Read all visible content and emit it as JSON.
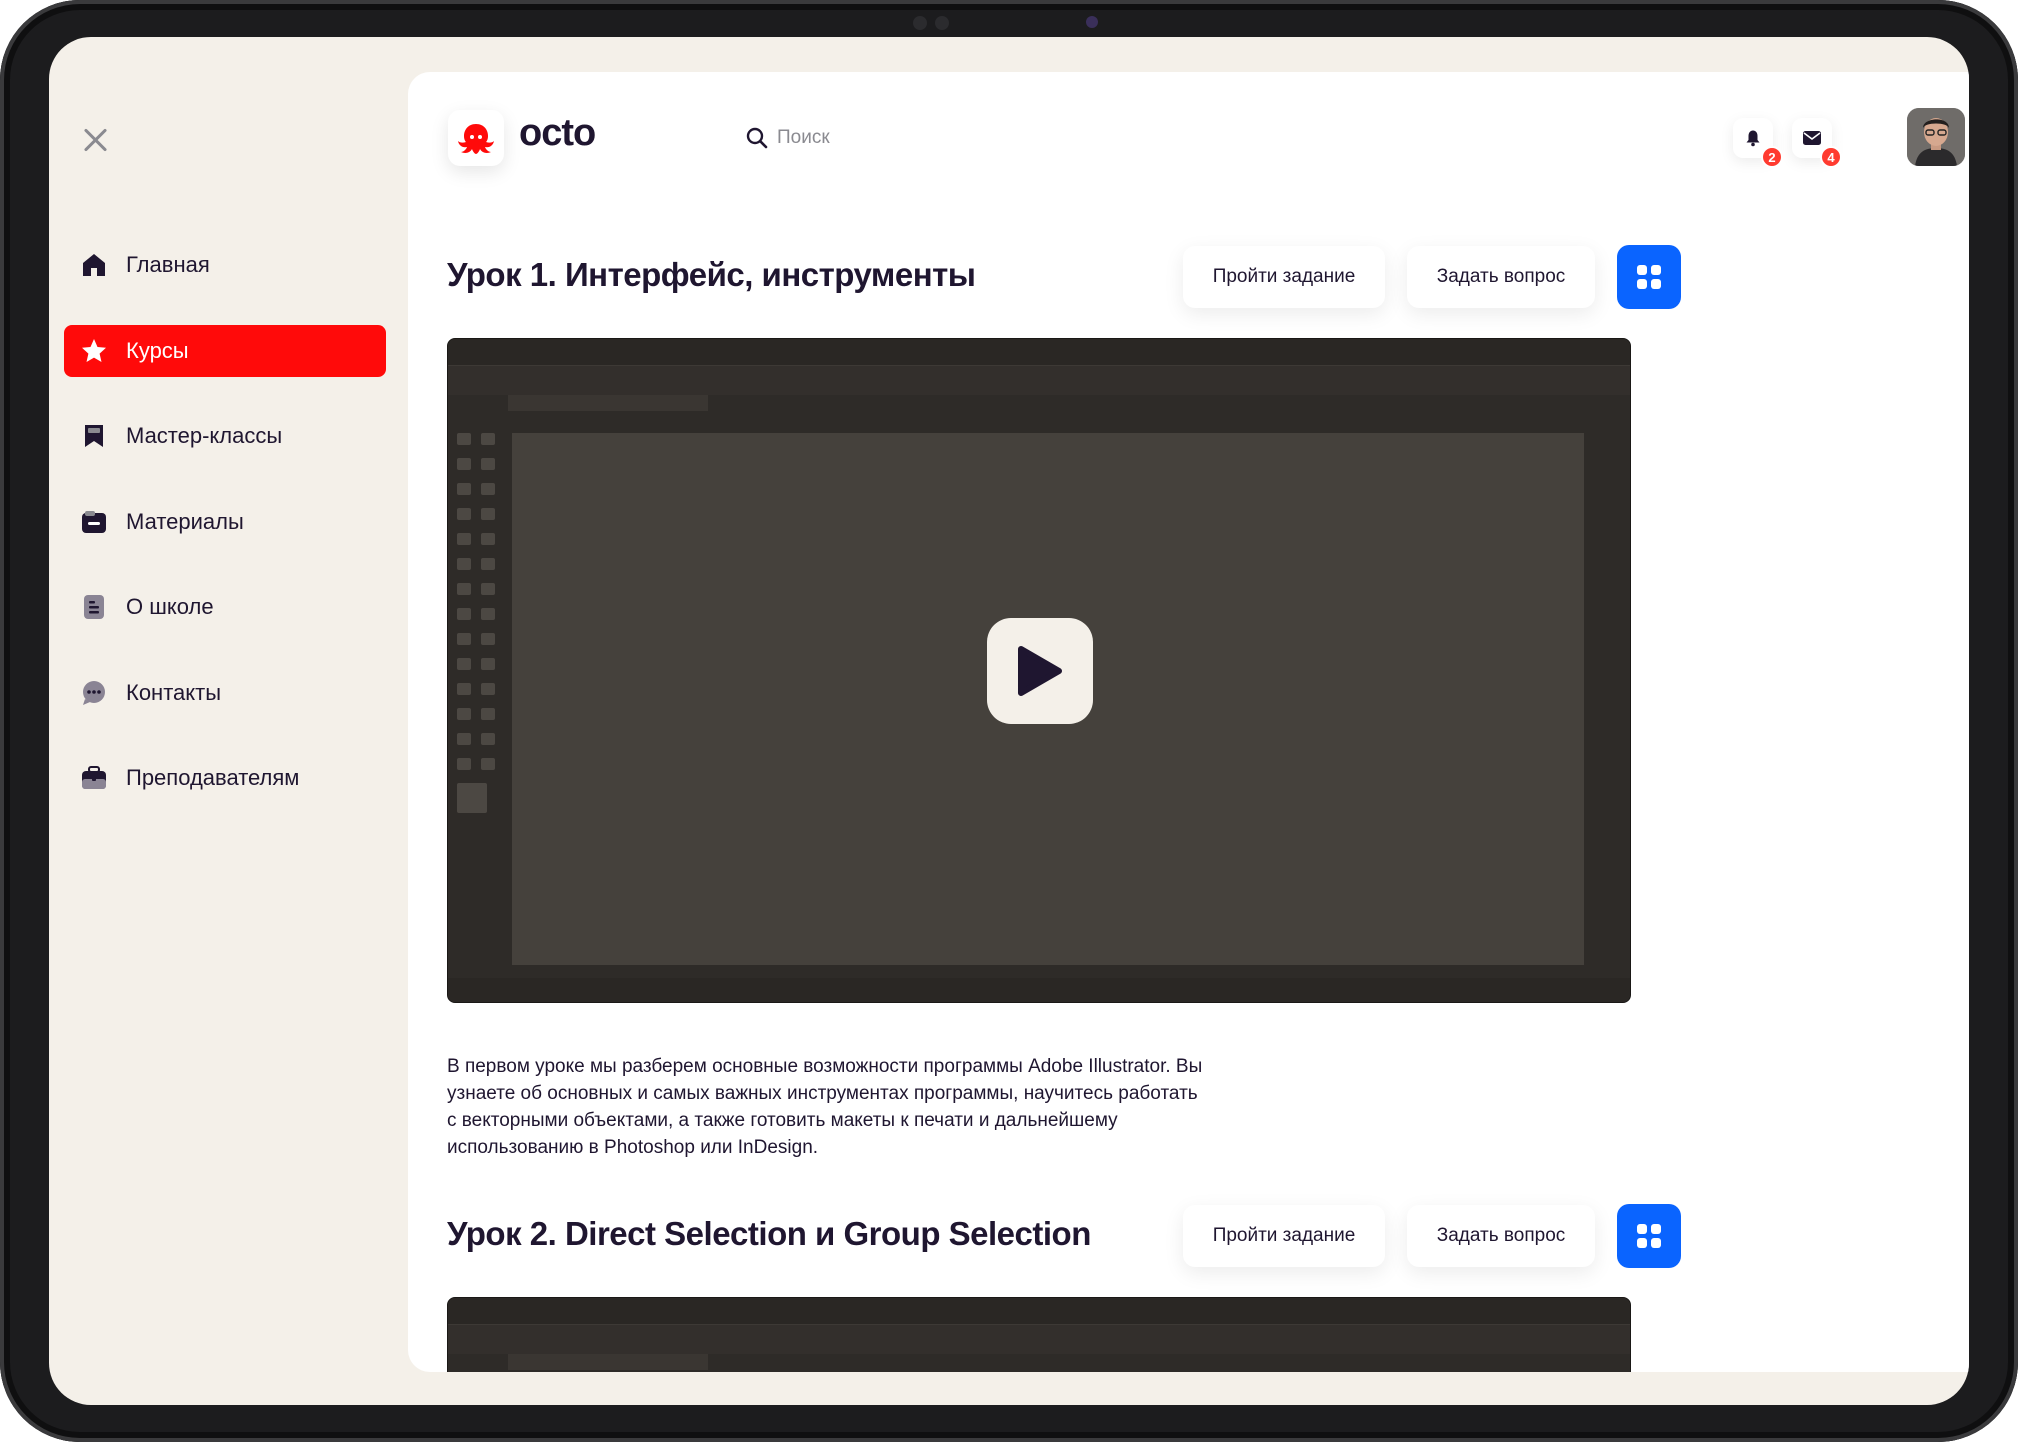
{
  "sidebar": {
    "items": [
      {
        "label": "Главная",
        "icon": "home-icon"
      },
      {
        "label": "Курсы",
        "icon": "star-icon",
        "active": true
      },
      {
        "label": "Мастер-классы",
        "icon": "bookmark-icon"
      },
      {
        "label": "Материалы",
        "icon": "folder-icon"
      },
      {
        "label": "О школе",
        "icon": "document-icon"
      },
      {
        "label": "Контакты",
        "icon": "chat-icon"
      },
      {
        "label": "Преподавателям",
        "icon": "briefcase-icon"
      }
    ]
  },
  "header": {
    "brand": "octo",
    "search_placeholder": "Поиск",
    "notifications_count": "2",
    "messages_count": "4"
  },
  "lessons": [
    {
      "title": "Урок 1. Интерфейс, инструменты",
      "task_button": "Пройти задание",
      "ask_button": "Задать вопрос",
      "description": "В первом уроке мы разберем основные возможности программы Adobe Illustrator. Вы узнаете об основных и самых важных инструментах программы, научитесь работать с векторными объектами, а также готовить макеты к печати и дальнейшему использованию в Photoshop или InDesign."
    },
    {
      "title": "Урок 2. Direct Selection и Group Selection",
      "task_button": "Пройти задание",
      "ask_button": "Задать вопрос"
    }
  ],
  "colors": {
    "accent_red": "#ff0a0a",
    "accent_blue": "#0a64ff",
    "text_dark": "#1f1630",
    "background_beige": "#f4f0e9",
    "badge_red": "#ff3b30"
  }
}
